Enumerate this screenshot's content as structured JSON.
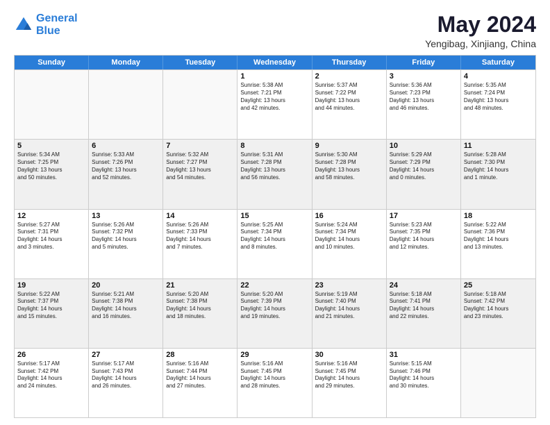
{
  "header": {
    "logo_line1": "General",
    "logo_line2": "Blue",
    "month_year": "May 2024",
    "location": "Yengibag, Xinjiang, China"
  },
  "days_of_week": [
    "Sunday",
    "Monday",
    "Tuesday",
    "Wednesday",
    "Thursday",
    "Friday",
    "Saturday"
  ],
  "rows": [
    [
      {
        "day": "",
        "text": "",
        "empty": true
      },
      {
        "day": "",
        "text": "",
        "empty": true
      },
      {
        "day": "",
        "text": "",
        "empty": true
      },
      {
        "day": "1",
        "text": "Sunrise: 5:38 AM\nSunset: 7:21 PM\nDaylight: 13 hours\nand 42 minutes."
      },
      {
        "day": "2",
        "text": "Sunrise: 5:37 AM\nSunset: 7:22 PM\nDaylight: 13 hours\nand 44 minutes."
      },
      {
        "day": "3",
        "text": "Sunrise: 5:36 AM\nSunset: 7:23 PM\nDaylight: 13 hours\nand 46 minutes."
      },
      {
        "day": "4",
        "text": "Sunrise: 5:35 AM\nSunset: 7:24 PM\nDaylight: 13 hours\nand 48 minutes."
      }
    ],
    [
      {
        "day": "5",
        "text": "Sunrise: 5:34 AM\nSunset: 7:25 PM\nDaylight: 13 hours\nand 50 minutes."
      },
      {
        "day": "6",
        "text": "Sunrise: 5:33 AM\nSunset: 7:26 PM\nDaylight: 13 hours\nand 52 minutes."
      },
      {
        "day": "7",
        "text": "Sunrise: 5:32 AM\nSunset: 7:27 PM\nDaylight: 13 hours\nand 54 minutes."
      },
      {
        "day": "8",
        "text": "Sunrise: 5:31 AM\nSunset: 7:28 PM\nDaylight: 13 hours\nand 56 minutes."
      },
      {
        "day": "9",
        "text": "Sunrise: 5:30 AM\nSunset: 7:28 PM\nDaylight: 13 hours\nand 58 minutes."
      },
      {
        "day": "10",
        "text": "Sunrise: 5:29 AM\nSunset: 7:29 PM\nDaylight: 14 hours\nand 0 minutes."
      },
      {
        "day": "11",
        "text": "Sunrise: 5:28 AM\nSunset: 7:30 PM\nDaylight: 14 hours\nand 1 minute."
      }
    ],
    [
      {
        "day": "12",
        "text": "Sunrise: 5:27 AM\nSunset: 7:31 PM\nDaylight: 14 hours\nand 3 minutes."
      },
      {
        "day": "13",
        "text": "Sunrise: 5:26 AM\nSunset: 7:32 PM\nDaylight: 14 hours\nand 5 minutes."
      },
      {
        "day": "14",
        "text": "Sunrise: 5:26 AM\nSunset: 7:33 PM\nDaylight: 14 hours\nand 7 minutes."
      },
      {
        "day": "15",
        "text": "Sunrise: 5:25 AM\nSunset: 7:34 PM\nDaylight: 14 hours\nand 8 minutes."
      },
      {
        "day": "16",
        "text": "Sunrise: 5:24 AM\nSunset: 7:34 PM\nDaylight: 14 hours\nand 10 minutes."
      },
      {
        "day": "17",
        "text": "Sunrise: 5:23 AM\nSunset: 7:35 PM\nDaylight: 14 hours\nand 12 minutes."
      },
      {
        "day": "18",
        "text": "Sunrise: 5:22 AM\nSunset: 7:36 PM\nDaylight: 14 hours\nand 13 minutes."
      }
    ],
    [
      {
        "day": "19",
        "text": "Sunrise: 5:22 AM\nSunset: 7:37 PM\nDaylight: 14 hours\nand 15 minutes."
      },
      {
        "day": "20",
        "text": "Sunrise: 5:21 AM\nSunset: 7:38 PM\nDaylight: 14 hours\nand 16 minutes."
      },
      {
        "day": "21",
        "text": "Sunrise: 5:20 AM\nSunset: 7:38 PM\nDaylight: 14 hours\nand 18 minutes."
      },
      {
        "day": "22",
        "text": "Sunrise: 5:20 AM\nSunset: 7:39 PM\nDaylight: 14 hours\nand 19 minutes."
      },
      {
        "day": "23",
        "text": "Sunrise: 5:19 AM\nSunset: 7:40 PM\nDaylight: 14 hours\nand 21 minutes."
      },
      {
        "day": "24",
        "text": "Sunrise: 5:18 AM\nSunset: 7:41 PM\nDaylight: 14 hours\nand 22 minutes."
      },
      {
        "day": "25",
        "text": "Sunrise: 5:18 AM\nSunset: 7:42 PM\nDaylight: 14 hours\nand 23 minutes."
      }
    ],
    [
      {
        "day": "26",
        "text": "Sunrise: 5:17 AM\nSunset: 7:42 PM\nDaylight: 14 hours\nand 24 minutes."
      },
      {
        "day": "27",
        "text": "Sunrise: 5:17 AM\nSunset: 7:43 PM\nDaylight: 14 hours\nand 26 minutes."
      },
      {
        "day": "28",
        "text": "Sunrise: 5:16 AM\nSunset: 7:44 PM\nDaylight: 14 hours\nand 27 minutes."
      },
      {
        "day": "29",
        "text": "Sunrise: 5:16 AM\nSunset: 7:45 PM\nDaylight: 14 hours\nand 28 minutes."
      },
      {
        "day": "30",
        "text": "Sunrise: 5:16 AM\nSunset: 7:45 PM\nDaylight: 14 hours\nand 29 minutes."
      },
      {
        "day": "31",
        "text": "Sunrise: 5:15 AM\nSunset: 7:46 PM\nDaylight: 14 hours\nand 30 minutes."
      },
      {
        "day": "",
        "text": "",
        "empty": true
      }
    ]
  ]
}
